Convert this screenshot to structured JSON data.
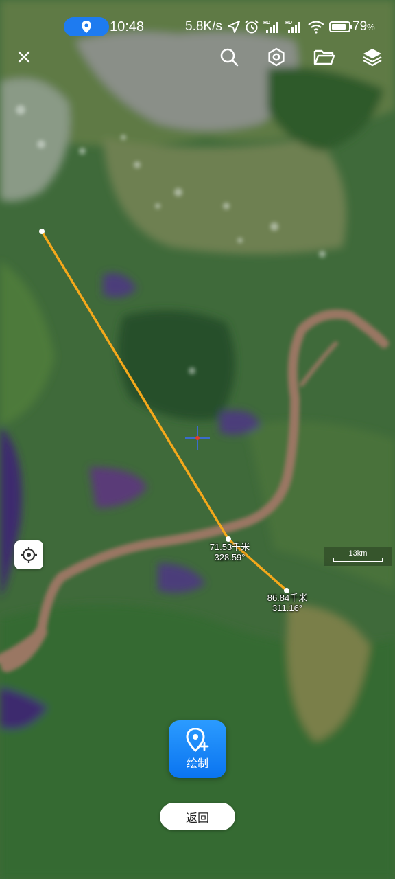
{
  "status_bar": {
    "time": "10:48",
    "net_rate": "5.8K/s",
    "battery_value": "79",
    "battery_unit": "%",
    "icons": [
      "location-icon",
      "navigation-arrow-icon",
      "alarm-icon",
      "hd-signal-icon",
      "hd-signal-icon",
      "wifi-icon",
      "battery-icon"
    ]
  },
  "toolbar": {
    "icons": [
      "close-icon",
      "search-icon",
      "settings-icon",
      "folder-icon",
      "layers-icon"
    ]
  },
  "map": {
    "type": "satellite",
    "route_color": "#f4a81b",
    "center_marker_color": "#3b6df0",
    "waypoints": [
      {
        "distance": "",
        "bearing": ""
      },
      {
        "distance": "71.53千米",
        "bearing": "328.59°"
      },
      {
        "distance": "86.84千米",
        "bearing": "311.16°"
      }
    ],
    "scale_label": "13km"
  },
  "controls": {
    "locate_icon": "crosshair-icon",
    "draw_label": "绘制",
    "draw_icon": "map-pin-plus-icon",
    "back_label": "返回"
  },
  "colors": {
    "accent": "#1e7bf0",
    "route": "#f4a81b"
  }
}
